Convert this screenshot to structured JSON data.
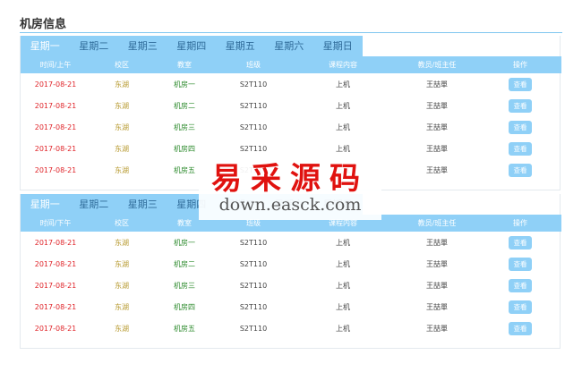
{
  "page": {
    "title": "机房信息"
  },
  "tabs": [
    "星期一",
    "星期二",
    "星期三",
    "星期四",
    "星期五",
    "星期六",
    "星期日"
  ],
  "columns_am": [
    "时间/上午",
    "校区",
    "教室",
    "班级",
    "课程内容",
    "教员/班主任",
    "操作"
  ],
  "columns_pm": [
    "时间/下午",
    "校区",
    "教室",
    "班级",
    "课程内容",
    "教员/班主任",
    "操作"
  ],
  "rows_am": [
    {
      "date": "2017-08-21",
      "campus": "东湖",
      "room": "机房一",
      "class": "S2T110",
      "content": "上机",
      "teacher": "王喆單",
      "action": "查看"
    },
    {
      "date": "2017-08-21",
      "campus": "东湖",
      "room": "机房二",
      "class": "S2T110",
      "content": "上机",
      "teacher": "王喆單",
      "action": "查看"
    },
    {
      "date": "2017-08-21",
      "campus": "东湖",
      "room": "机房三",
      "class": "S2T110",
      "content": "上机",
      "teacher": "王喆單",
      "action": "查看"
    },
    {
      "date": "2017-08-21",
      "campus": "东湖",
      "room": "机房四",
      "class": "S2T110",
      "content": "上机",
      "teacher": "王喆單",
      "action": "查看"
    },
    {
      "date": "2017-08-21",
      "campus": "东湖",
      "room": "机房五",
      "class": "S2T110",
      "content": "上机",
      "teacher": "王喆單",
      "action": "查看"
    }
  ],
  "rows_pm": [
    {
      "date": "2017-08-21",
      "campus": "东湖",
      "room": "机房一",
      "class": "S2T110",
      "content": "上机",
      "teacher": "王喆單",
      "action": "查看"
    },
    {
      "date": "2017-08-21",
      "campus": "东湖",
      "room": "机房二",
      "class": "S2T110",
      "content": "上机",
      "teacher": "王喆單",
      "action": "查看"
    },
    {
      "date": "2017-08-21",
      "campus": "东湖",
      "room": "机房三",
      "class": "S2T110",
      "content": "上机",
      "teacher": "王喆單",
      "action": "查看"
    },
    {
      "date": "2017-08-21",
      "campus": "东湖",
      "room": "机房四",
      "class": "S2T110",
      "content": "上机",
      "teacher": "王喆單",
      "action": "查看"
    },
    {
      "date": "2017-08-21",
      "campus": "东湖",
      "room": "机房五",
      "class": "S2T110",
      "content": "上机",
      "teacher": "王喆單",
      "action": "查看"
    }
  ],
  "watermark": {
    "main": "易采源码",
    "sub": "down.easck.com"
  },
  "colors": {
    "accent": "#8fd0f7",
    "date": "#e0252a",
    "campus": "#b6982c",
    "room": "#2e8b2e",
    "watermark": "#e0120f"
  }
}
